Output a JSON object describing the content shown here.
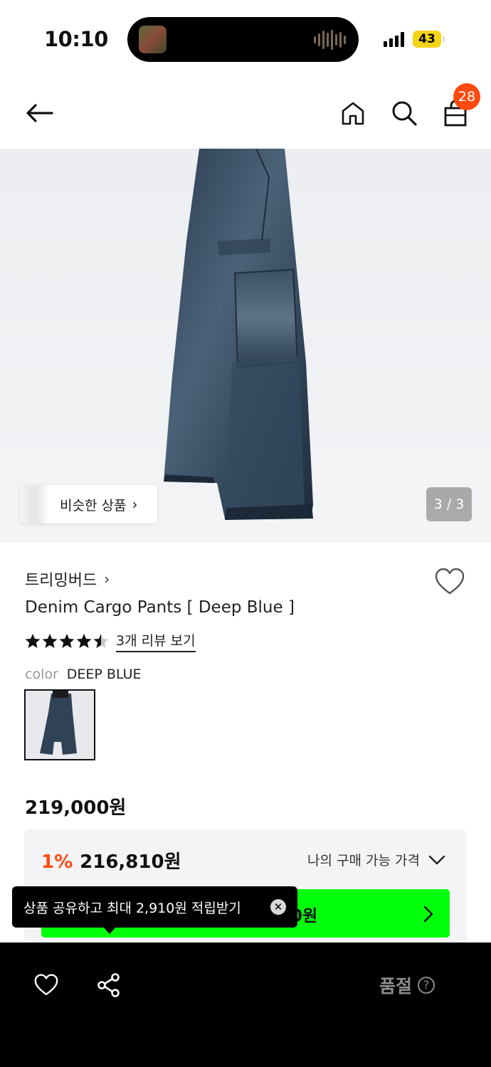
{
  "status_bar": {
    "time": "10:10",
    "battery": "43"
  },
  "nav": {
    "back_icon": "arrow-left-icon",
    "home_icon": "home-icon",
    "search_icon": "search-icon",
    "cart_icon": "shopping-bag-icon",
    "cart_count": "28"
  },
  "gallery": {
    "similar_label": "비슷한 상품",
    "similar_chevron": "›",
    "pager": "3 / 3"
  },
  "product": {
    "brand": "트리밍버드",
    "brand_chevron": "›",
    "title": "Denim Cargo Pants [ Deep Blue ]",
    "rating": 4.5,
    "review_link": "3개 리뷰 보기",
    "color_label": "color",
    "color_value": "DEEP BLUE",
    "price": "219,000원"
  },
  "price_box": {
    "discount_rate": "1%",
    "discount_price": "216,810원",
    "available_label": "나의 구매 가능 가격",
    "green_text": "10원",
    "green_color": "#00ff0a"
  },
  "tooltip": {
    "text": "상품 공유하고 최대 2,910원 적립받기",
    "close": "✕"
  },
  "bottom_bar": {
    "like_icon": "heart-icon",
    "share_icon": "share-icon",
    "soldout_label": "품절",
    "help": "?"
  },
  "colors": {
    "accent": "#ff4a0f",
    "green": "#00ff0a",
    "bottom_bg": "#000000"
  }
}
